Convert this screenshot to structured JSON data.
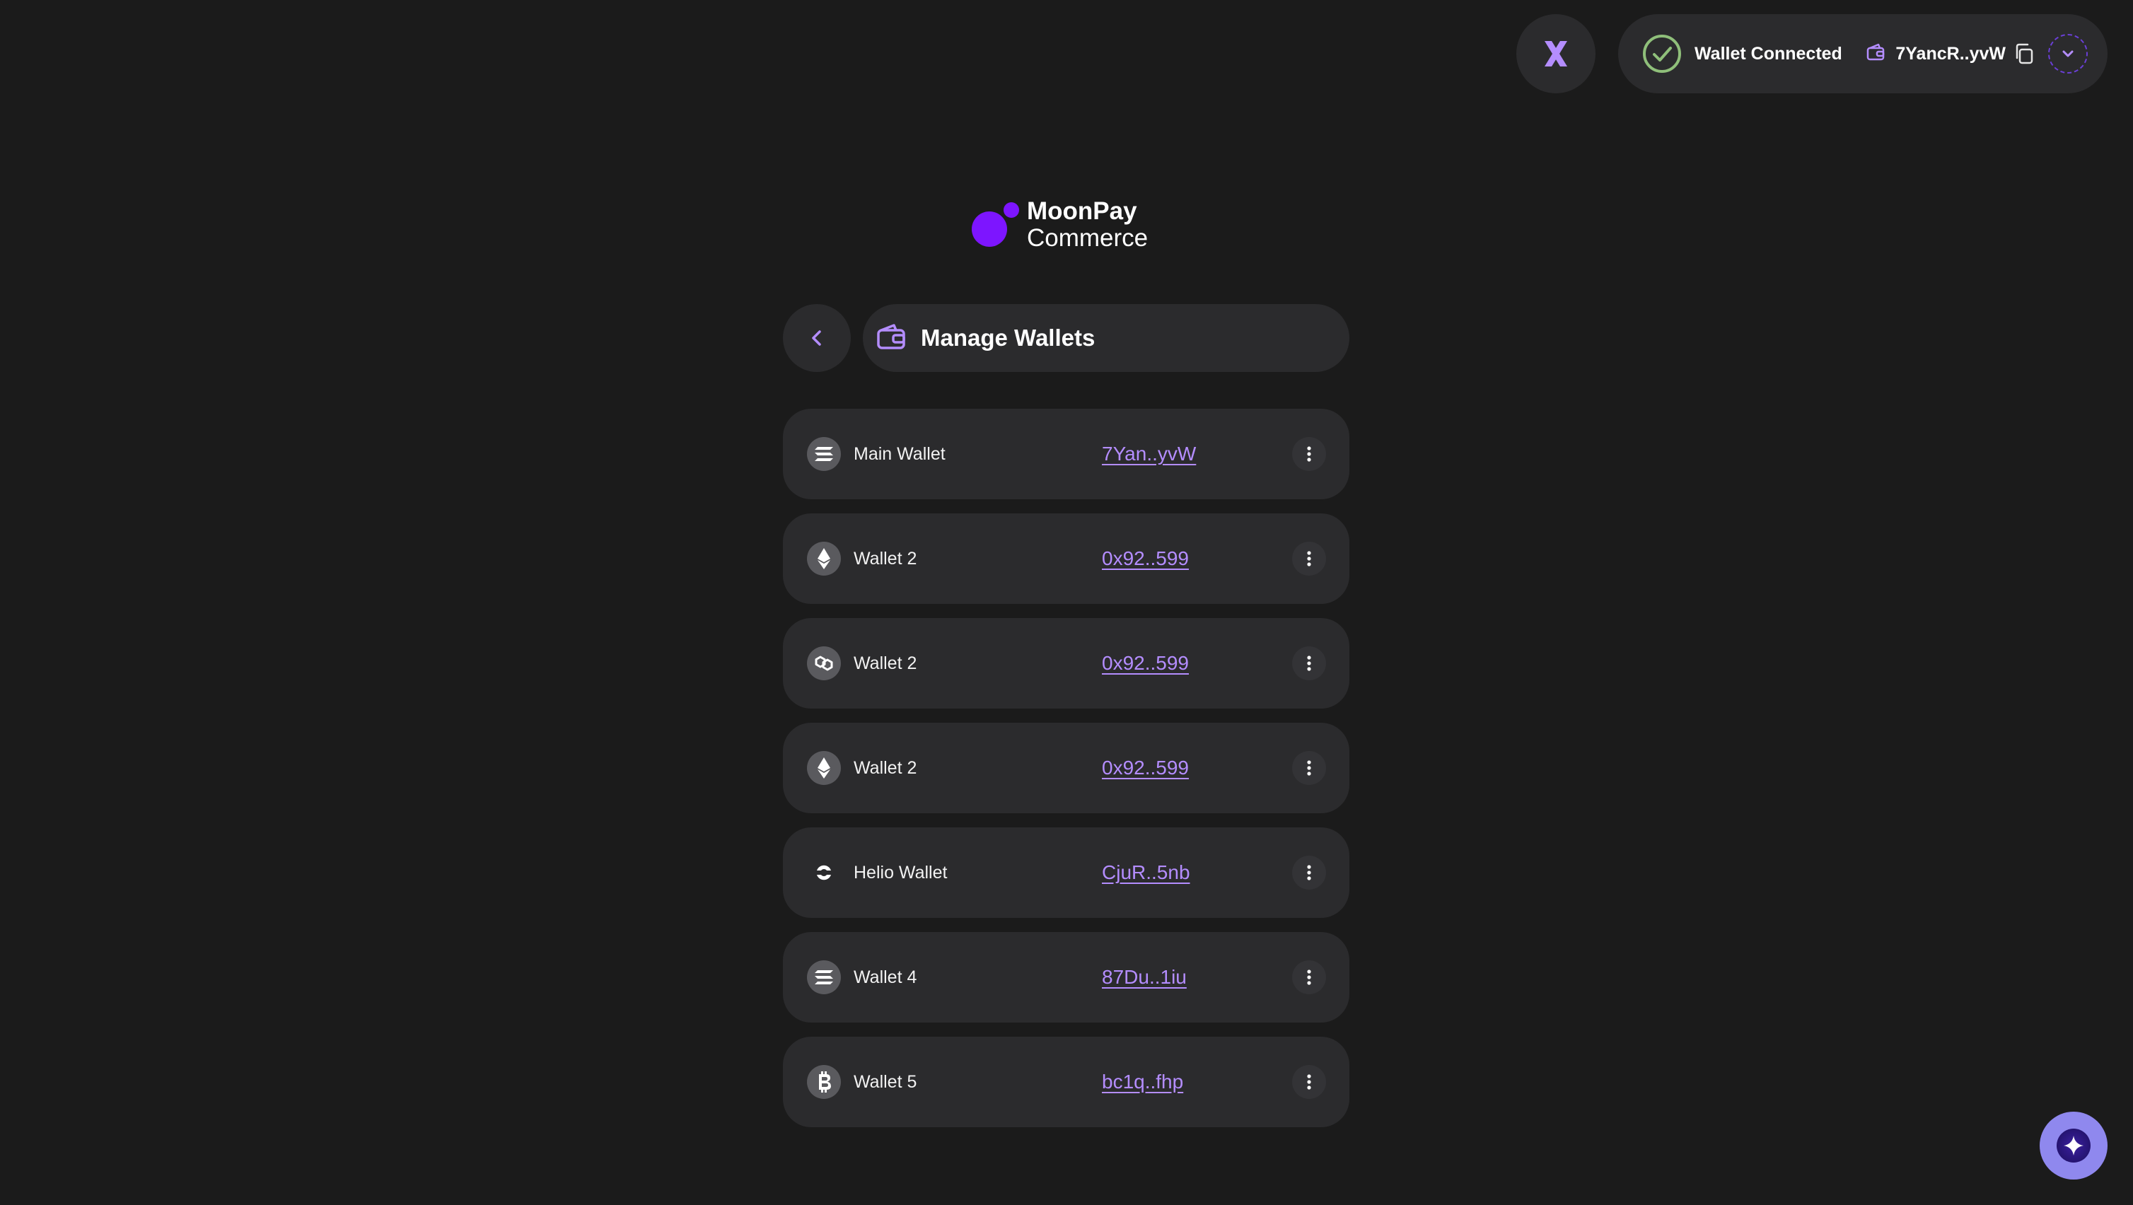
{
  "topbar": {
    "status_label": "Wallet Connected",
    "connected_address": "7YancR..yvW",
    "status_color": "#8fbf7a",
    "accent_color": "#b48dff"
  },
  "brand": {
    "line1": "MoonPay",
    "line2": "Commerce",
    "color": "#7d15ff"
  },
  "header": {
    "title": "Manage Wallets"
  },
  "wallets": [
    {
      "name": "Main Wallet",
      "address": "7Yan..yvW",
      "chain_icon": "solana-icon"
    },
    {
      "name": "Wallet 2",
      "address": "0x92..599",
      "chain_icon": "ethereum-icon"
    },
    {
      "name": "Wallet 2",
      "address": "0x92..599",
      "chain_icon": "polygon-icon"
    },
    {
      "name": "Wallet 2",
      "address": "0x92..599",
      "chain_icon": "ethereum-icon"
    },
    {
      "name": "Helio Wallet",
      "address": "CjuR..5nb",
      "chain_icon": "helio-icon"
    },
    {
      "name": "Wallet 4",
      "address": "87Du..1iu",
      "chain_icon": "solana-icon"
    },
    {
      "name": "Wallet 5",
      "address": "bc1q..fhp",
      "chain_icon": "bitcoin-icon"
    }
  ]
}
